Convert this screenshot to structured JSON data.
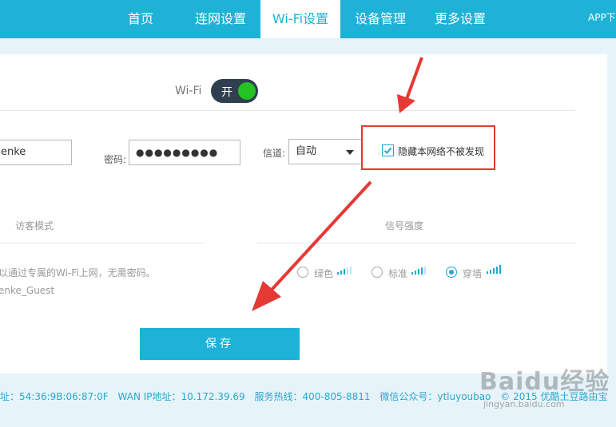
{
  "nav": {
    "items": [
      "首页",
      "连网设置",
      "Wi-Fi设置",
      "设备管理",
      "更多设置"
    ],
    "active_index": 2,
    "app_link": "APP下"
  },
  "wifi": {
    "label": "Wi-Fi",
    "toggle_label": "开",
    "toggle_on": true
  },
  "form": {
    "ssid_value": "enke",
    "password_label": "密码:",
    "password_value": "●●●●●●●●●",
    "channel_label": "信道:",
    "channel_value": "自动",
    "hide_network_label": "隐藏本网络不被发现",
    "hide_network_checked": true
  },
  "guest": {
    "title": "访客模式",
    "description": "以通过专属的Wi-Fi上网，无需密码。",
    "ssid": "enke_Guest"
  },
  "signal": {
    "title": "信号强度",
    "options": [
      {
        "label": "绿色",
        "selected": false
      },
      {
        "label": "标准",
        "selected": false
      },
      {
        "label": "穿墙",
        "selected": true
      }
    ]
  },
  "actions": {
    "save_label": "保存"
  },
  "footer": {
    "mac": "址：54:36:9B:06:87:0F",
    "wan_ip": "WAN IP地址：10.172.39.69",
    "hotline": "服务热线：400-805-8811",
    "wechat": "微信公众号：ytluyoubao",
    "copyright": "© 2015 优酷土豆路由宝"
  },
  "watermark": {
    "logo": "Baidu经验",
    "url": "jingyan.baidu.com"
  },
  "colors": {
    "brand": "#1eb2d6",
    "toggle_bg": "#2f3f50",
    "toggle_knob": "#22c322",
    "highlight": "#e53935"
  }
}
